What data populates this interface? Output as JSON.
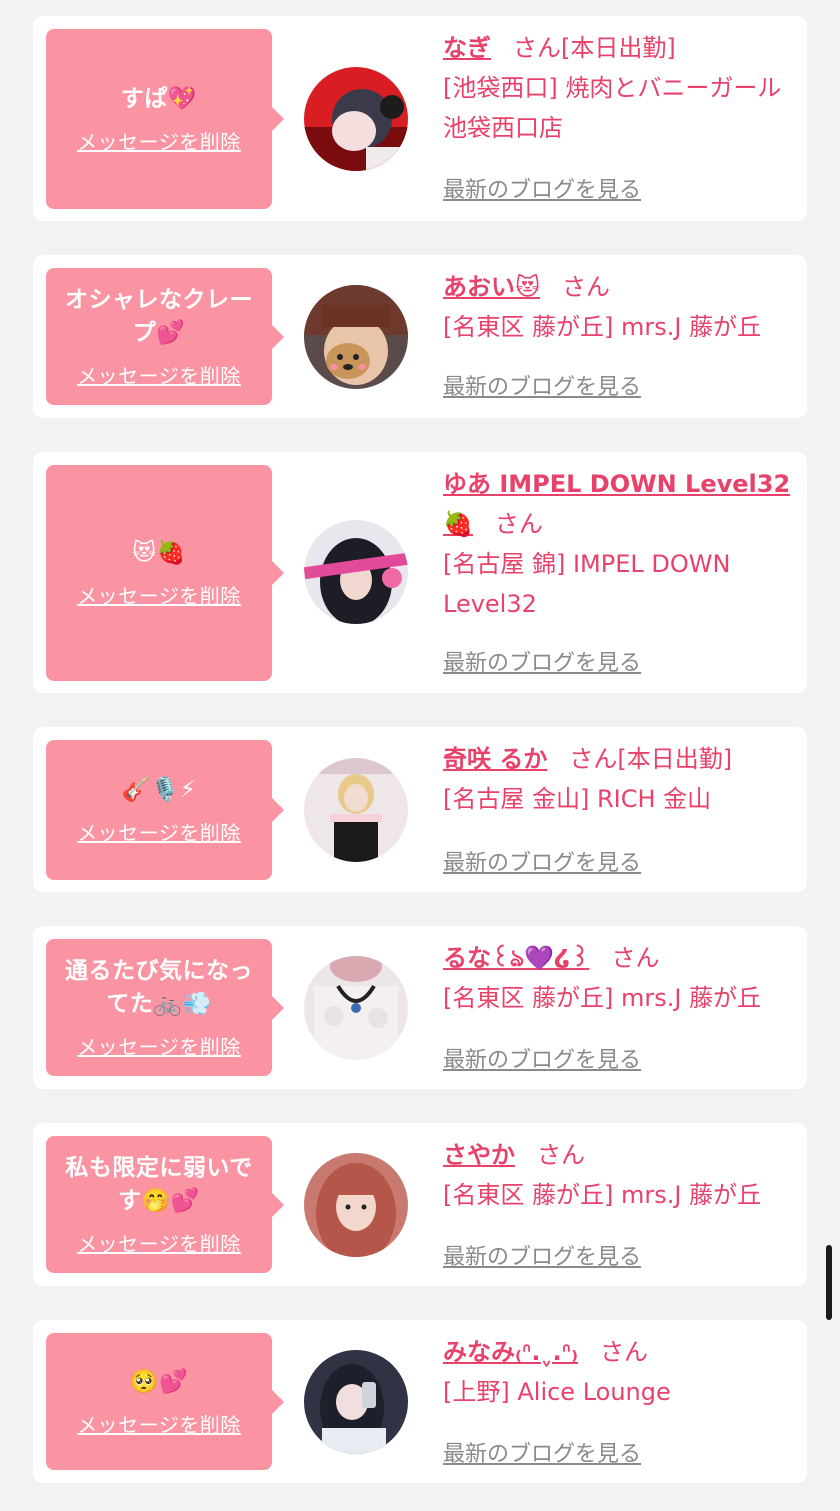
{
  "delete_label": "メッセージを削除",
  "blog_label": "最新のブログを見る",
  "san_label": "さん",
  "colors": {
    "bubble": "#fa93a2",
    "accent": "#e8426b",
    "link_gray": "#8a8a8a",
    "background": "#f2f2f2"
  },
  "items": [
    {
      "message": "すぱ💖",
      "name": "なぎ",
      "status": "[本日出勤]",
      "shop": "[池袋西口] 焼肉とバニーガール 池袋西口店",
      "avatar_icon": "avatar-photo"
    },
    {
      "message": "オシャレなクレープ💕",
      "name": "あおい😻",
      "status": "",
      "shop": "[名東区 藤が丘] mrs.J 藤が丘",
      "avatar_icon": "avatar-photo"
    },
    {
      "message": "😻🍓",
      "name": "ゆあ IMPEL DOWN Level32 🍓",
      "status": "",
      "shop": "[名古屋 錦] IMPEL DOWN Level32",
      "avatar_icon": "avatar-photo"
    },
    {
      "message": "🎸🎙️⚡",
      "name": "奇咲 るか",
      "status": "[本日出勤]",
      "shop": "[名古屋 金山] RICH 金山",
      "avatar_icon": "avatar-photo"
    },
    {
      "message": "通るたび気になってた🚲💨",
      "name": "るな꒰ঌ💜໒꒱",
      "status": "",
      "shop": "[名東区 藤が丘] mrs.J 藤が丘",
      "avatar_icon": "avatar-photo"
    },
    {
      "message": "私も限定に弱いです🤭💕",
      "name": "さやか",
      "status": "",
      "shop": "[名東区 藤が丘] mrs.J 藤が丘",
      "avatar_icon": "avatar-photo"
    },
    {
      "message": "🥺💕",
      "name": "みなみ₍ᐢ.ˬ.ᐢ₎",
      "status": "",
      "shop": "[上野] Alice Lounge",
      "avatar_icon": "avatar-photo"
    }
  ]
}
